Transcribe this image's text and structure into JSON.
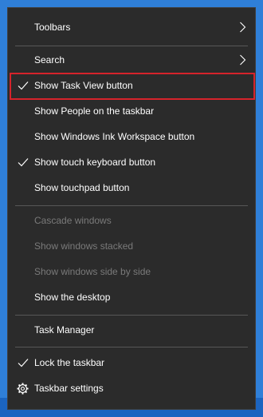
{
  "menu": {
    "toolbars": "Toolbars",
    "search": "Search",
    "show_task_view": "Show Task View button",
    "show_people": "Show People on the taskbar",
    "show_ink": "Show Windows Ink Workspace button",
    "show_touch_keyboard": "Show touch keyboard button",
    "show_touchpad": "Show touchpad button",
    "cascade": "Cascade windows",
    "stacked": "Show windows stacked",
    "side_by_side": "Show windows side by side",
    "show_desktop": "Show the desktop",
    "task_manager": "Task Manager",
    "lock_taskbar": "Lock the taskbar",
    "taskbar_settings": "Taskbar settings"
  },
  "colors": {
    "menu_bg": "#2b2b2b",
    "highlight_border": "#d6232b",
    "disabled_text": "#7a7a7a",
    "desktop_bg": "#2f7fd8"
  },
  "icons": {
    "check": "check-icon",
    "submenu": "chevron-right-icon",
    "settings": "gear-icon"
  }
}
